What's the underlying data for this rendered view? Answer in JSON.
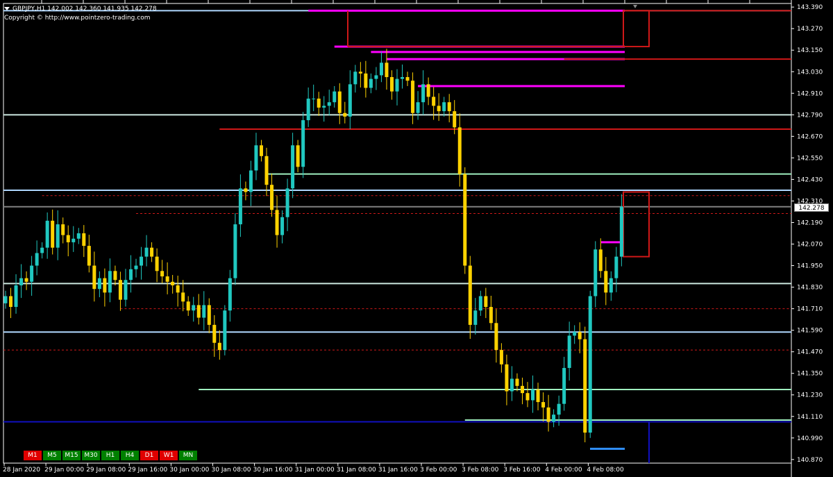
{
  "header": {
    "symbol_info": "GBPJPY,H1  142.002 142.360 141.935 142.278",
    "copyright": "Copyright © http://www.pointzero-trading.com"
  },
  "timeframes": [
    {
      "label": "M1",
      "color": "red"
    },
    {
      "label": "M5",
      "color": "green"
    },
    {
      "label": "M15",
      "color": "green"
    },
    {
      "label": "M30",
      "color": "green"
    },
    {
      "label": "H1",
      "color": "green"
    },
    {
      "label": "H4",
      "color": "green"
    },
    {
      "label": "D1",
      "color": "red"
    },
    {
      "label": "W1",
      "color": "red"
    },
    {
      "label": "MN",
      "color": "green"
    }
  ],
  "current_price": "142.278",
  "chart_data": {
    "type": "candlestick",
    "symbol": "GBPJPY",
    "timeframe": "H1",
    "ylim": [
      140.85,
      143.41
    ],
    "price_ticks": [
      "143.390",
      "143.270",
      "143.150",
      "143.030",
      "142.910",
      "142.790",
      "142.670",
      "142.550",
      "142.430",
      "142.310",
      "142.190",
      "142.070",
      "141.950",
      "141.830",
      "141.710",
      "141.590",
      "141.470",
      "141.350",
      "141.230",
      "141.110",
      "140.990",
      "140.870"
    ],
    "time_labels": [
      "28 Jan 2020",
      "29 Jan 00:00",
      "29 Jan 08:00",
      "29 Jan 16:00",
      "30 Jan 00:00",
      "30 Jan 08:00",
      "30 Jan 16:00",
      "31 Jan 00:00",
      "31 Jan 08:00",
      "31 Jan 16:00",
      "3 Feb 00:00",
      "3 Feb 08:00",
      "3 Feb 16:00",
      "4 Feb 00:00",
      "4 Feb 08:00"
    ],
    "colors": {
      "bull": "#20c8c0",
      "bear": "#ffd200",
      "background": "#000000"
    },
    "closes": [
      141.78,
      141.72,
      141.84,
      141.88,
      141.86,
      141.95,
      142.02,
      142.05,
      142.2,
      142.05,
      142.18,
      142.12,
      142.08,
      142.1,
      142.13,
      142.06,
      141.95,
      141.82,
      141.88,
      141.8,
      141.92,
      141.87,
      141.76,
      141.87,
      141.93,
      141.95,
      142.0,
      142.05,
      142.0,
      141.92,
      141.89,
      141.86,
      141.84,
      141.8,
      141.75,
      141.7,
      141.73,
      141.66,
      141.73,
      141.62,
      141.52,
      141.48,
      141.7,
      141.88,
      142.18,
      142.38,
      142.36,
      142.48,
      142.62,
      142.56,
      142.4,
      142.26,
      142.12,
      142.22,
      142.38,
      142.62,
      142.5,
      142.76,
      142.88,
      142.88,
      142.83,
      142.84,
      142.86,
      142.92,
      142.8,
      142.78,
      142.96,
      143.03,
      143.02,
      142.94,
      142.99,
      143.01,
      143.08,
      143.0,
      142.92,
      142.99,
      143.0,
      142.98,
      142.8,
      142.86,
      142.96,
      142.89,
      142.84,
      142.81,
      142.86,
      142.81,
      142.72,
      142.46,
      141.95,
      141.62,
      141.7,
      141.78,
      141.72,
      141.63,
      141.48,
      141.4,
      141.25,
      141.32,
      141.28,
      141.24,
      141.2,
      141.26,
      141.19,
      141.16,
      141.08,
      141.12,
      141.18,
      141.38,
      141.56,
      141.58,
      141.54,
      141.02,
      141.78,
      142.04,
      141.92,
      141.8,
      141.88,
      142.0,
      142.278
    ],
    "levels": [
      {
        "price": 143.37,
        "color": "#b0d8ff",
        "style": "solid",
        "from_bar": 0
      },
      {
        "price": 142.79,
        "color": "#cde8e0",
        "style": "solid",
        "from_bar": 0
      },
      {
        "price": 142.37,
        "color": "#b0d8ff",
        "style": "solid",
        "from_bar": 0
      },
      {
        "price": 141.85,
        "color": "#cde8e0",
        "style": "solid",
        "from_bar": 0
      },
      {
        "price": 141.58,
        "color": "#b0d8ff",
        "style": "solid",
        "from_bar": 0
      },
      {
        "price": 141.08,
        "color": "#1010c0",
        "style": "solid",
        "from_bar": 0
      },
      {
        "price": 143.37,
        "color": "#ff00ff",
        "style": "solid",
        "from_bar": 58
      },
      {
        "price": 143.17,
        "color": "#ff00ff",
        "style": "solid",
        "from_bar": 63
      },
      {
        "price": 143.14,
        "color": "#ff00ff",
        "style": "solid",
        "from_bar": 70
      },
      {
        "price": 143.1,
        "color": "#ff00ff",
        "style": "solid",
        "from_bar": 73
      },
      {
        "price": 142.95,
        "color": "#ff00ff",
        "style": "solid",
        "from_bar": 79
      },
      {
        "price": 142.71,
        "color": "#d01818",
        "style": "solid",
        "from_bar": 41
      },
      {
        "price": 142.46,
        "color": "#a0f0c0",
        "style": "solid",
        "from_bar": 50
      },
      {
        "price": 141.26,
        "color": "#a0f0c0",
        "style": "solid",
        "from_bar": 37
      },
      {
        "price": 141.09,
        "color": "#a0f0c0",
        "style": "solid",
        "from_bar": 88
      },
      {
        "price": 143.1,
        "color": "#d01818",
        "style": "solid",
        "from_bar": 107
      },
      {
        "price": 142.34,
        "color": "#d01818",
        "style": "dashed",
        "from_bar": 7
      },
      {
        "price": 142.24,
        "color": "#d01818",
        "style": "dashed",
        "from_bar": 25
      },
      {
        "price": 141.71,
        "color": "#d01818",
        "style": "dashed",
        "from_bar": 22
      },
      {
        "price": 141.48,
        "color": "#d01818",
        "style": "dashed",
        "from_bar": 0
      },
      {
        "price": 142.278,
        "color": "#808080",
        "style": "solid",
        "from_bar": 0
      }
    ]
  }
}
